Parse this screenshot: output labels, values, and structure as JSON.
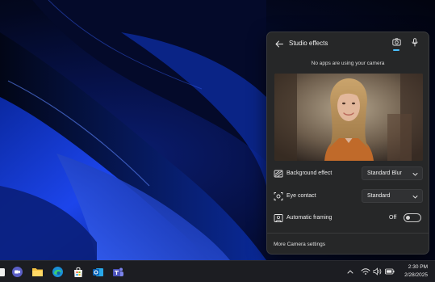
{
  "flyout": {
    "title": "Studio effects",
    "status": "No apps are using your camera",
    "effects": [
      {
        "label": "Background effect",
        "value": "Standard Blur"
      },
      {
        "label": "Eye contact",
        "value": "Standard"
      }
    ],
    "framing": {
      "label": "Automatic framing",
      "state": "Off"
    },
    "more_link": "More Camera settings"
  },
  "taskbar": {
    "time": "2:30 PM",
    "date": "2/28/2025"
  },
  "colors": {
    "accent": "#4cc2ff",
    "flyout_bg": "#262728",
    "taskbar_bg": "#1c1d22"
  }
}
